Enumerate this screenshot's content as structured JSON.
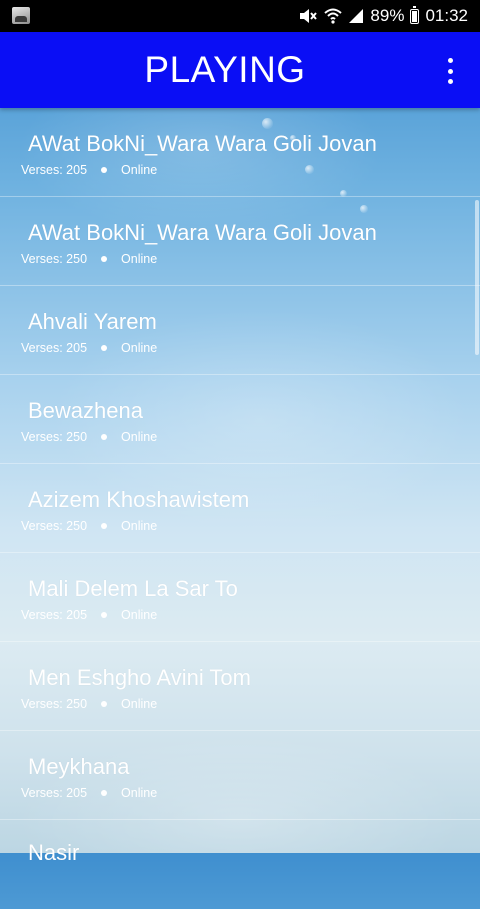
{
  "status_bar": {
    "battery": "89%",
    "time": "01:32"
  },
  "app_bar": {
    "title": "PLAYING"
  },
  "songs": [
    {
      "title": "AWat BokNi_Wara Wara Goli Jovan",
      "verses": "Verses: 205",
      "status": "Online"
    },
    {
      "title": "AWat BokNi_Wara Wara Goli Jovan",
      "verses": "Verses: 250",
      "status": "Online"
    },
    {
      "title": "Ahvali Yarem",
      "verses": "Verses: 205",
      "status": "Online"
    },
    {
      "title": "Bewazhena",
      "verses": "Verses: 250",
      "status": "Online"
    },
    {
      "title": "Azizem Khoshawistem",
      "verses": "Verses: 250",
      "status": "Online"
    },
    {
      "title": "Mali Delem La Sar To",
      "verses": "Verses: 205",
      "status": "Online"
    },
    {
      "title": "Men Eshgho Avini Tom",
      "verses": "Verses: 250",
      "status": "Online"
    },
    {
      "title": "Meykhana",
      "verses": "Verses: 205",
      "status": "Online"
    },
    {
      "title": "Nasir",
      "verses": "",
      "status": ""
    }
  ]
}
